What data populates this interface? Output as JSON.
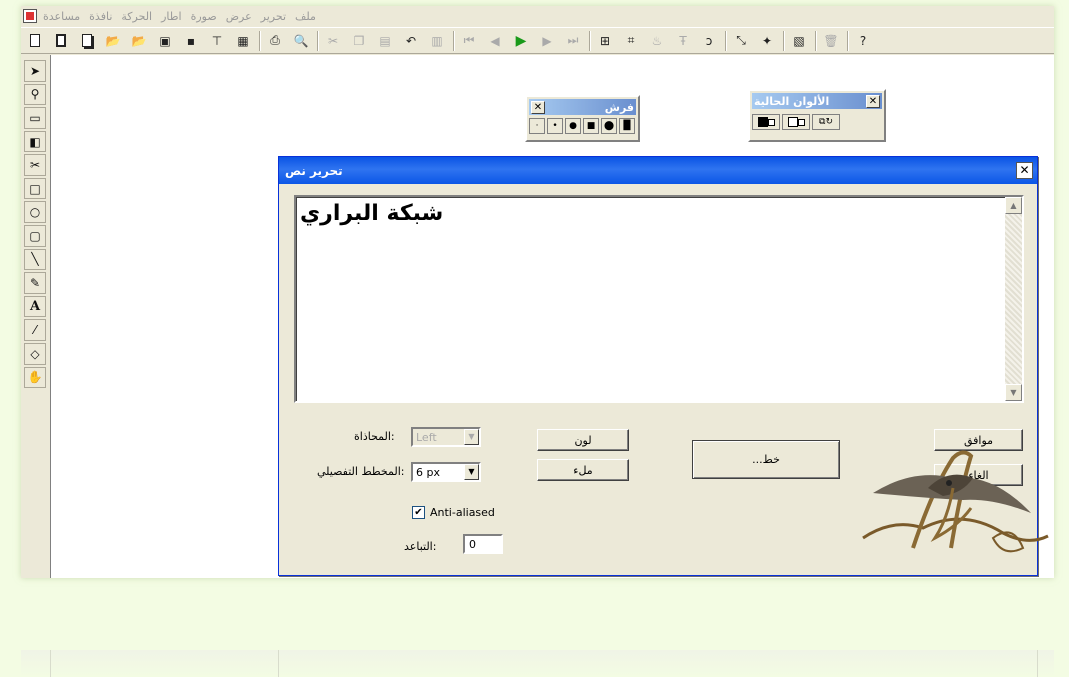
{
  "menubar": {
    "items": [
      "ملف",
      "تحرير",
      "عرض",
      "صورة",
      "اطار",
      "الحركة",
      "نافذة",
      "مساعدة"
    ]
  },
  "toolbar": {
    "icons": [
      "new-document-icon",
      "new-from-template-icon",
      "copy-document-icon",
      "open-folder-icon",
      "open-folder-recent-icon",
      "save-all-icon",
      "save-icon",
      "funnel-icon",
      "export-icon",
      "print-icon",
      "print-preview-icon",
      "cut-icon",
      "copy-icon",
      "paste-icon",
      "undo-icon",
      "redo-icon",
      "first-frame-icon",
      "previous-frame-icon",
      "play-icon",
      "next-frame-icon",
      "last-frame-icon",
      "frame-tool-icon",
      "crop-icon",
      "stamp-icon",
      "text-frame-icon",
      "lasso-icon",
      "transform-icon",
      "new-layer-icon",
      "properties-icon",
      "trash-icon",
      "help-icon"
    ]
  },
  "tools": [
    "arrow-tool-icon",
    "zoom-tool-icon",
    "rect-select-tool-icon",
    "gradient-tool-icon",
    "scissors-tool-icon",
    "rectangle-tool-icon",
    "ellipse-tool-icon",
    "rounded-rect-tool-icon",
    "line-tool-icon",
    "pencil-tool-icon",
    "text-tool-icon",
    "eyedropper-tool-icon",
    "eraser-tool-icon",
    "fill-tool-icon"
  ],
  "brush_palette": {
    "title": "فرش",
    "close": "✕"
  },
  "colors_palette": {
    "title": "الألوان الحالية",
    "close": "✕"
  },
  "dialog": {
    "title": "تحرير نص",
    "close": "✕",
    "text": "شبكة البراري",
    "alignment_label": ":المحاذاة",
    "alignment_value": "Left",
    "outline_label": ":المخطط التفصيلي",
    "outline_value": "6 px",
    "anti_aliased_label": "Anti-aliased",
    "anti_aliased_checked": true,
    "spacing_label": ":التباعد",
    "spacing_value": "0",
    "color_button": "لون",
    "fill_button": "ملء",
    "font_button": "...خط",
    "ok_button": "موافق",
    "cancel_button": "الغاء"
  },
  "watermark": {
    "text": "بسام البوشة"
  }
}
